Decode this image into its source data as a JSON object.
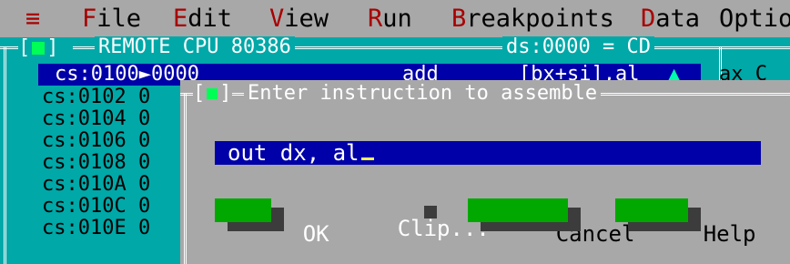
{
  "menubar": {
    "system_glyph": "≡",
    "items": [
      {
        "hot": "F",
        "rest": "ile"
      },
      {
        "hot": "E",
        "rest": "dit"
      },
      {
        "hot": "V",
        "rest": "iew"
      },
      {
        "hot": "R",
        "rest": "un"
      },
      {
        "hot": "B",
        "rest": "reakpoints"
      },
      {
        "hot": "D",
        "rest": "ata"
      },
      {
        "hot": "",
        "rest": "Option"
      }
    ]
  },
  "cpu_window": {
    "title": "REMOTE CPU 80386",
    "ds_info": "ds:0000 = CD",
    "rows": [
      {
        "addr": "cs:0100►0000",
        "mnem": "add",
        "ops": "[bx+si],al",
        "selected": true
      },
      {
        "addr": "cs:0102 0"
      },
      {
        "addr": "cs:0104 0"
      },
      {
        "addr": "cs:0106 0"
      },
      {
        "addr": "cs:0108 0"
      },
      {
        "addr": "cs:010A 0"
      },
      {
        "addr": "cs:010C 0"
      },
      {
        "addr": "cs:010E 0"
      }
    ],
    "scroll_up_glyph": "▲",
    "register": "ax C"
  },
  "dialog": {
    "title": "Enter instruction to assemble",
    "input_value": "out dx, al",
    "buttons": {
      "ok": "OK",
      "clip": "Clip...",
      "cancel": "Cancel",
      "help": "Help"
    }
  },
  "colors": {
    "menubar_bg": "#a8a8a8",
    "hotkey": "#a80000",
    "window_bg": "#00a8a8",
    "selection_bg": "#0000a8",
    "dialog_bg": "#a8a8a8",
    "button_bg": "#00a800"
  }
}
